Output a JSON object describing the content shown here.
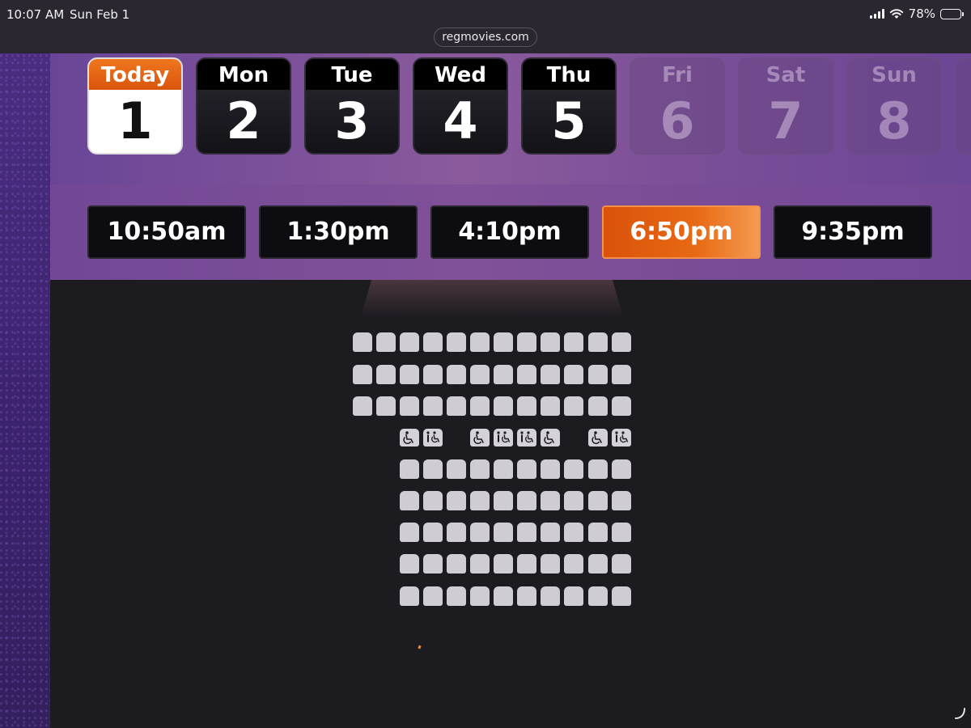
{
  "status_bar": {
    "time": "10:07 AM",
    "date": "Sun Feb 1",
    "battery": "78%",
    "battery_level": 0.78
  },
  "browser": {
    "url": "regmovies.com"
  },
  "days": [
    {
      "name": "Today",
      "num": "1",
      "state": "selected"
    },
    {
      "name": "Mon",
      "num": "2",
      "state": "available"
    },
    {
      "name": "Tue",
      "num": "3",
      "state": "available"
    },
    {
      "name": "Wed",
      "num": "4",
      "state": "available"
    },
    {
      "name": "Thu",
      "num": "5",
      "state": "available"
    },
    {
      "name": "Fri",
      "num": "6",
      "state": "disabled"
    },
    {
      "name": "Sat",
      "num": "7",
      "state": "disabled"
    },
    {
      "name": "Sun",
      "num": "8",
      "state": "disabled"
    }
  ],
  "showtimes": [
    {
      "label": "10:50am",
      "selected": false
    },
    {
      "label": "1:30pm",
      "selected": false
    },
    {
      "label": "4:10pm",
      "selected": false
    },
    {
      "label": "6:50pm",
      "selected": true
    },
    {
      "label": "9:35pm",
      "selected": false
    }
  ],
  "seating": {
    "rows": [
      {
        "type": "standard",
        "seats": [
          1,
          1,
          1,
          1,
          1,
          1,
          1,
          1,
          1,
          1,
          1,
          1
        ]
      },
      {
        "type": "standard",
        "seats": [
          1,
          1,
          1,
          1,
          1,
          1,
          1,
          1,
          1,
          1,
          1,
          1
        ]
      },
      {
        "type": "standard",
        "seats": [
          1,
          1,
          1,
          1,
          1,
          1,
          1,
          1,
          1,
          1,
          1,
          1
        ]
      },
      {
        "type": "wheelchair",
        "seats": [
          0,
          0,
          2,
          3,
          0,
          2,
          3,
          3,
          2,
          0,
          2,
          3
        ]
      },
      {
        "type": "standard",
        "seats": [
          0,
          0,
          1,
          1,
          1,
          1,
          1,
          1,
          1,
          1,
          1,
          1
        ]
      },
      {
        "type": "standard",
        "seats": [
          0,
          0,
          1,
          1,
          1,
          1,
          1,
          1,
          1,
          1,
          1,
          1
        ]
      },
      {
        "type": "standard",
        "seats": [
          0,
          0,
          1,
          1,
          1,
          1,
          1,
          1,
          1,
          1,
          1,
          1
        ]
      },
      {
        "type": "standard",
        "seats": [
          0,
          0,
          1,
          1,
          1,
          1,
          1,
          1,
          1,
          1,
          1,
          1
        ]
      },
      {
        "type": "standard",
        "seats": [
          0,
          0,
          1,
          1,
          1,
          1,
          1,
          1,
          1,
          1,
          1,
          1
        ]
      }
    ],
    "seat_color": "#cfcdd3"
  },
  "colors": {
    "accent": "#e8600f",
    "header_purple": "#7a4f98",
    "background": "#1c1b20"
  }
}
